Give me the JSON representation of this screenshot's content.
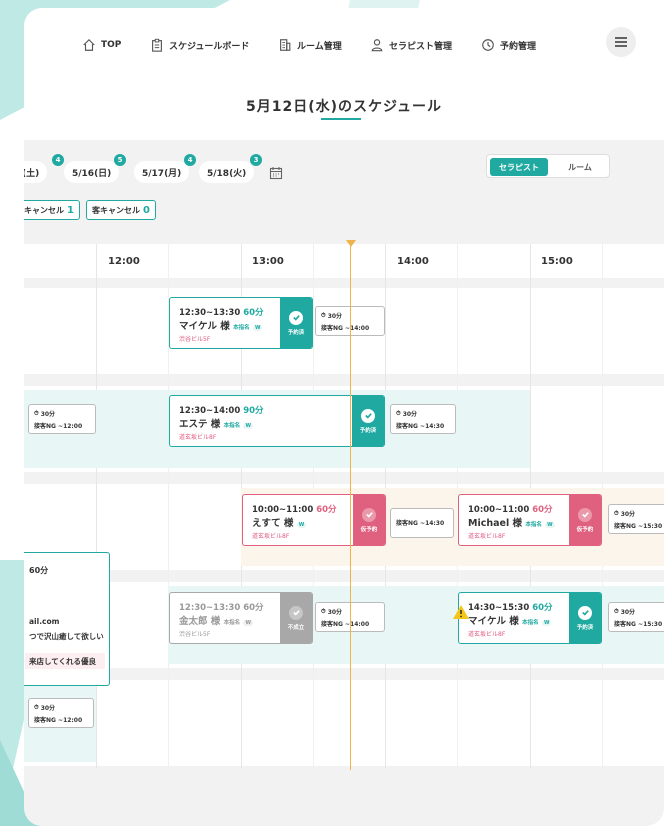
{
  "nav": {
    "items": [
      {
        "icon": "home-icon",
        "label": "TOP"
      },
      {
        "icon": "clipboard-icon",
        "label": "スケジュールボード"
      },
      {
        "icon": "building-icon",
        "label": "ルーム管理"
      },
      {
        "icon": "user-icon",
        "label": "セラピスト管理"
      },
      {
        "icon": "clock-icon",
        "label": "予約管理"
      }
    ],
    "menu_icon": "hamburger-icon"
  },
  "page": {
    "title": "5月12日(水)のスケジュール"
  },
  "dates": [
    {
      "label": "(土)",
      "count": "4"
    },
    {
      "label": "5/16(日)",
      "count": "5"
    },
    {
      "label": "5/17(月)",
      "count": "4"
    },
    {
      "label": "5/18(火)",
      "count": "3"
    }
  ],
  "view_toggle": {
    "active": "セラピスト",
    "inactive": "ルーム"
  },
  "cancels": [
    {
      "label": "キャンセル",
      "count": "1"
    },
    {
      "label": "客キャンセル",
      "count": "0"
    }
  ],
  "hours": [
    "12:00",
    "13:00",
    "14:00",
    "15:00"
  ],
  "appointments": [
    {
      "time": "12:30~13:30",
      "duration": "60分",
      "name": "マイケル 様",
      "tag": "本指名",
      "w": "W",
      "location": "渋谷ビル5F",
      "status": "予約済"
    },
    {
      "time": "12:30~14:00",
      "duration": "90分",
      "name": "エステ 様",
      "tag": "本指名",
      "w": "W",
      "location": "道玄坂ビル8F",
      "status": "予約済"
    },
    {
      "time": "10:00~11:00",
      "duration": "60分",
      "name": "えすて 様",
      "tag": "",
      "w": "W",
      "location": "道玄坂ビル8F",
      "status": "仮予約"
    },
    {
      "time": "10:00~11:00",
      "duration": "60分",
      "name": "Michael 様",
      "tag": "本指名",
      "w": "W",
      "location": "道玄坂ビル8F",
      "status": "仮予約"
    },
    {
      "time": "12:30~13:30",
      "duration": "60分",
      "name": "金太郎 様",
      "tag": "本指名",
      "w": "W",
      "location": "渋谷ビル5F",
      "status": "不成立"
    },
    {
      "time": "14:30~15:30",
      "duration": "60分",
      "name": "マイケル 様",
      "tag": "本指名",
      "w": "W",
      "location": "道玄坂ビル8F",
      "status": "予約済"
    }
  ],
  "breaks": {
    "b30": "30分",
    "ng1400": "接客NG ~14:00",
    "ng1200": "接客NG ~12:00",
    "ng1430": "接客NG ~14:30",
    "ng1530": "接客NG ~15:30"
  },
  "popup": {
    "duration": "60分",
    "email": "ail.com",
    "note": "つで沢山癒して欲しい",
    "highlight": "来店してくれる優良"
  },
  "colors": {
    "accent": "#1fa9a0",
    "pink": "#e0617f",
    "gray": "#a8a8a8",
    "now": "#f0b24a",
    "warning": "#f5c518"
  }
}
